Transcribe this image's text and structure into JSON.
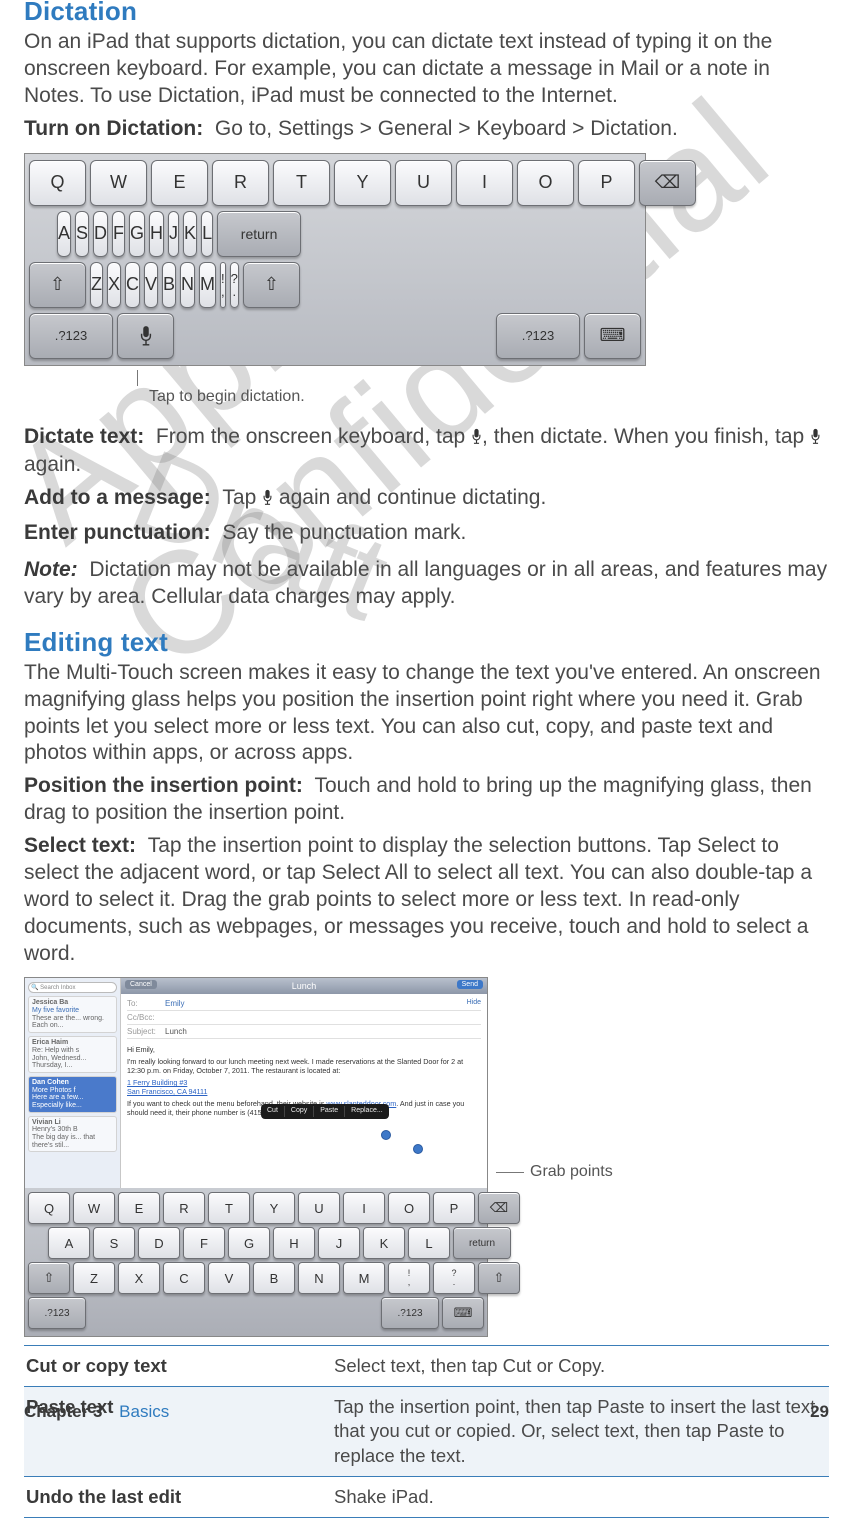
{
  "sections": {
    "dictation": {
      "heading": "Dictation",
      "intro": "On an iPad that supports dictation, you can dictate text instead of typing it on the onscreen keyboard. For example, you can dictate a message in Mail or a note in Notes. To use Dictation, iPad must be connected to the Internet.",
      "turn_on_label": "Turn on Dictation:",
      "turn_on_text": "Go to, Settings > General > Keyboard > Dictation.",
      "keyboard": {
        "row1": [
          "Q",
          "W",
          "E",
          "R",
          "T",
          "Y",
          "U",
          "I",
          "O",
          "P"
        ],
        "row2": [
          "A",
          "S",
          "D",
          "F",
          "G",
          "H",
          "J",
          "K",
          "L"
        ],
        "return_label": "return",
        "row3": [
          "Z",
          "X",
          "C",
          "V",
          "B",
          "N",
          "M"
        ],
        "punct1_top": "!",
        "punct1_bot": ",",
        "punct2_top": "?",
        "punct2_bot": ".",
        "num_label": ".?123",
        "backspace_icon": "⌫",
        "shift_icon": "⇧",
        "dismiss_icon": "⌨"
      },
      "callout": "Tap to begin dictation.",
      "dictate_label": "Dictate text:",
      "dictate_text_a": "From the onscreen keyboard, tap ",
      "dictate_text_b": ", then dictate. When you finish, tap ",
      "dictate_text_c": " again.",
      "add_label": "Add to a message:",
      "add_text_a": "Tap ",
      "add_text_b": " again and continue dictating.",
      "punct_label": "Enter punctuation:",
      "punct_text": "Say the punctuation mark.",
      "note_label": "Note:",
      "note_text": "Dictation may not be available in all languages or in all areas, and features may vary by area. Cellular data charges may apply."
    },
    "editing": {
      "heading": "Editing text",
      "intro": "The Multi-Touch screen makes it easy to change the text you've entered. An onscreen magnifying glass helps you position the insertion point right where you need it. Grab points let you select more or less text. You can also cut, copy, and paste text and photos within apps, or across apps.",
      "pos_label": "Position the insertion point:",
      "pos_text": "Touch and hold to bring up the magnifying glass, then drag to position the insertion point.",
      "sel_label": "Select text:",
      "sel_text": "Tap the insertion point to display the selection buttons. Tap Select to select the adjacent word, or tap Select All to select all text. You can also double-tap a word to select it. Drag the grab points to select more or less text. In read-only documents, such as webpages, or messages you receive, touch and hold to select a word.",
      "mail_fig": {
        "title": "Lunch",
        "cancel": "Cancel",
        "send": "Send",
        "hide": "Hide",
        "to_label": "To:",
        "to_value": "Emily",
        "cc_label": "Cc/Bcc:",
        "subj_label": "Subject:",
        "subj_value": "Lunch",
        "greeting": "Hi Emily,",
        "para1": "I'm really looking forward to our lunch meeting next week. I made reservations at the Slanted Door for 2 at 12:30 p.m. on Friday, October 7, 2011. The restaurant is located at:",
        "link1": "1 Ferry Building #3",
        "link2": "San Francisco, CA 94111",
        "para2a": "If you want to check out the menu beforehand, their website is ",
        "link3": "www.slanteddoor.com",
        "para2b": ". And just in case you should need it, their phone number is (415) 861-8032.",
        "menu": [
          "Cut",
          "Copy",
          "Paste",
          "Replace..."
        ],
        "side_items": [
          {
            "name": "Jessica Ba",
            "sub": "My five favorite",
            "body": "These are the...\nwrong. Each on..."
          },
          {
            "name": "Erica Haim",
            "sub": "Re: Help with s",
            "body": "John, Wednesd...\nThursday, I..."
          },
          {
            "name": "Dan Cohen",
            "sub": "More Photos f",
            "body": "Here are a few...\nEspecially like..."
          },
          {
            "name": "Vivian Li",
            "sub": "Henry's 30th B",
            "body": "The big day is...\nthat there's stil..."
          }
        ],
        "search_placeholder": "Search Inbox"
      },
      "grab_callout": "Grab points",
      "table": {
        "r1k": "Cut or copy text",
        "r1v": "Select text, then tap Cut or Copy.",
        "r2k": "Paste text",
        "r2v": "Tap the insertion point, then tap Paste to insert the last text that you cut or copied. Or, select text, then tap Paste to replace the text.",
        "r3k": "Undo the last edit",
        "r3v": "Shake iPad."
      }
    }
  },
  "footer": {
    "chapter": "Chapter 3",
    "section": "Basics",
    "page": "29"
  },
  "watermarks": {
    "draft": "Draft",
    "confidential": "Apple Confidential"
  }
}
